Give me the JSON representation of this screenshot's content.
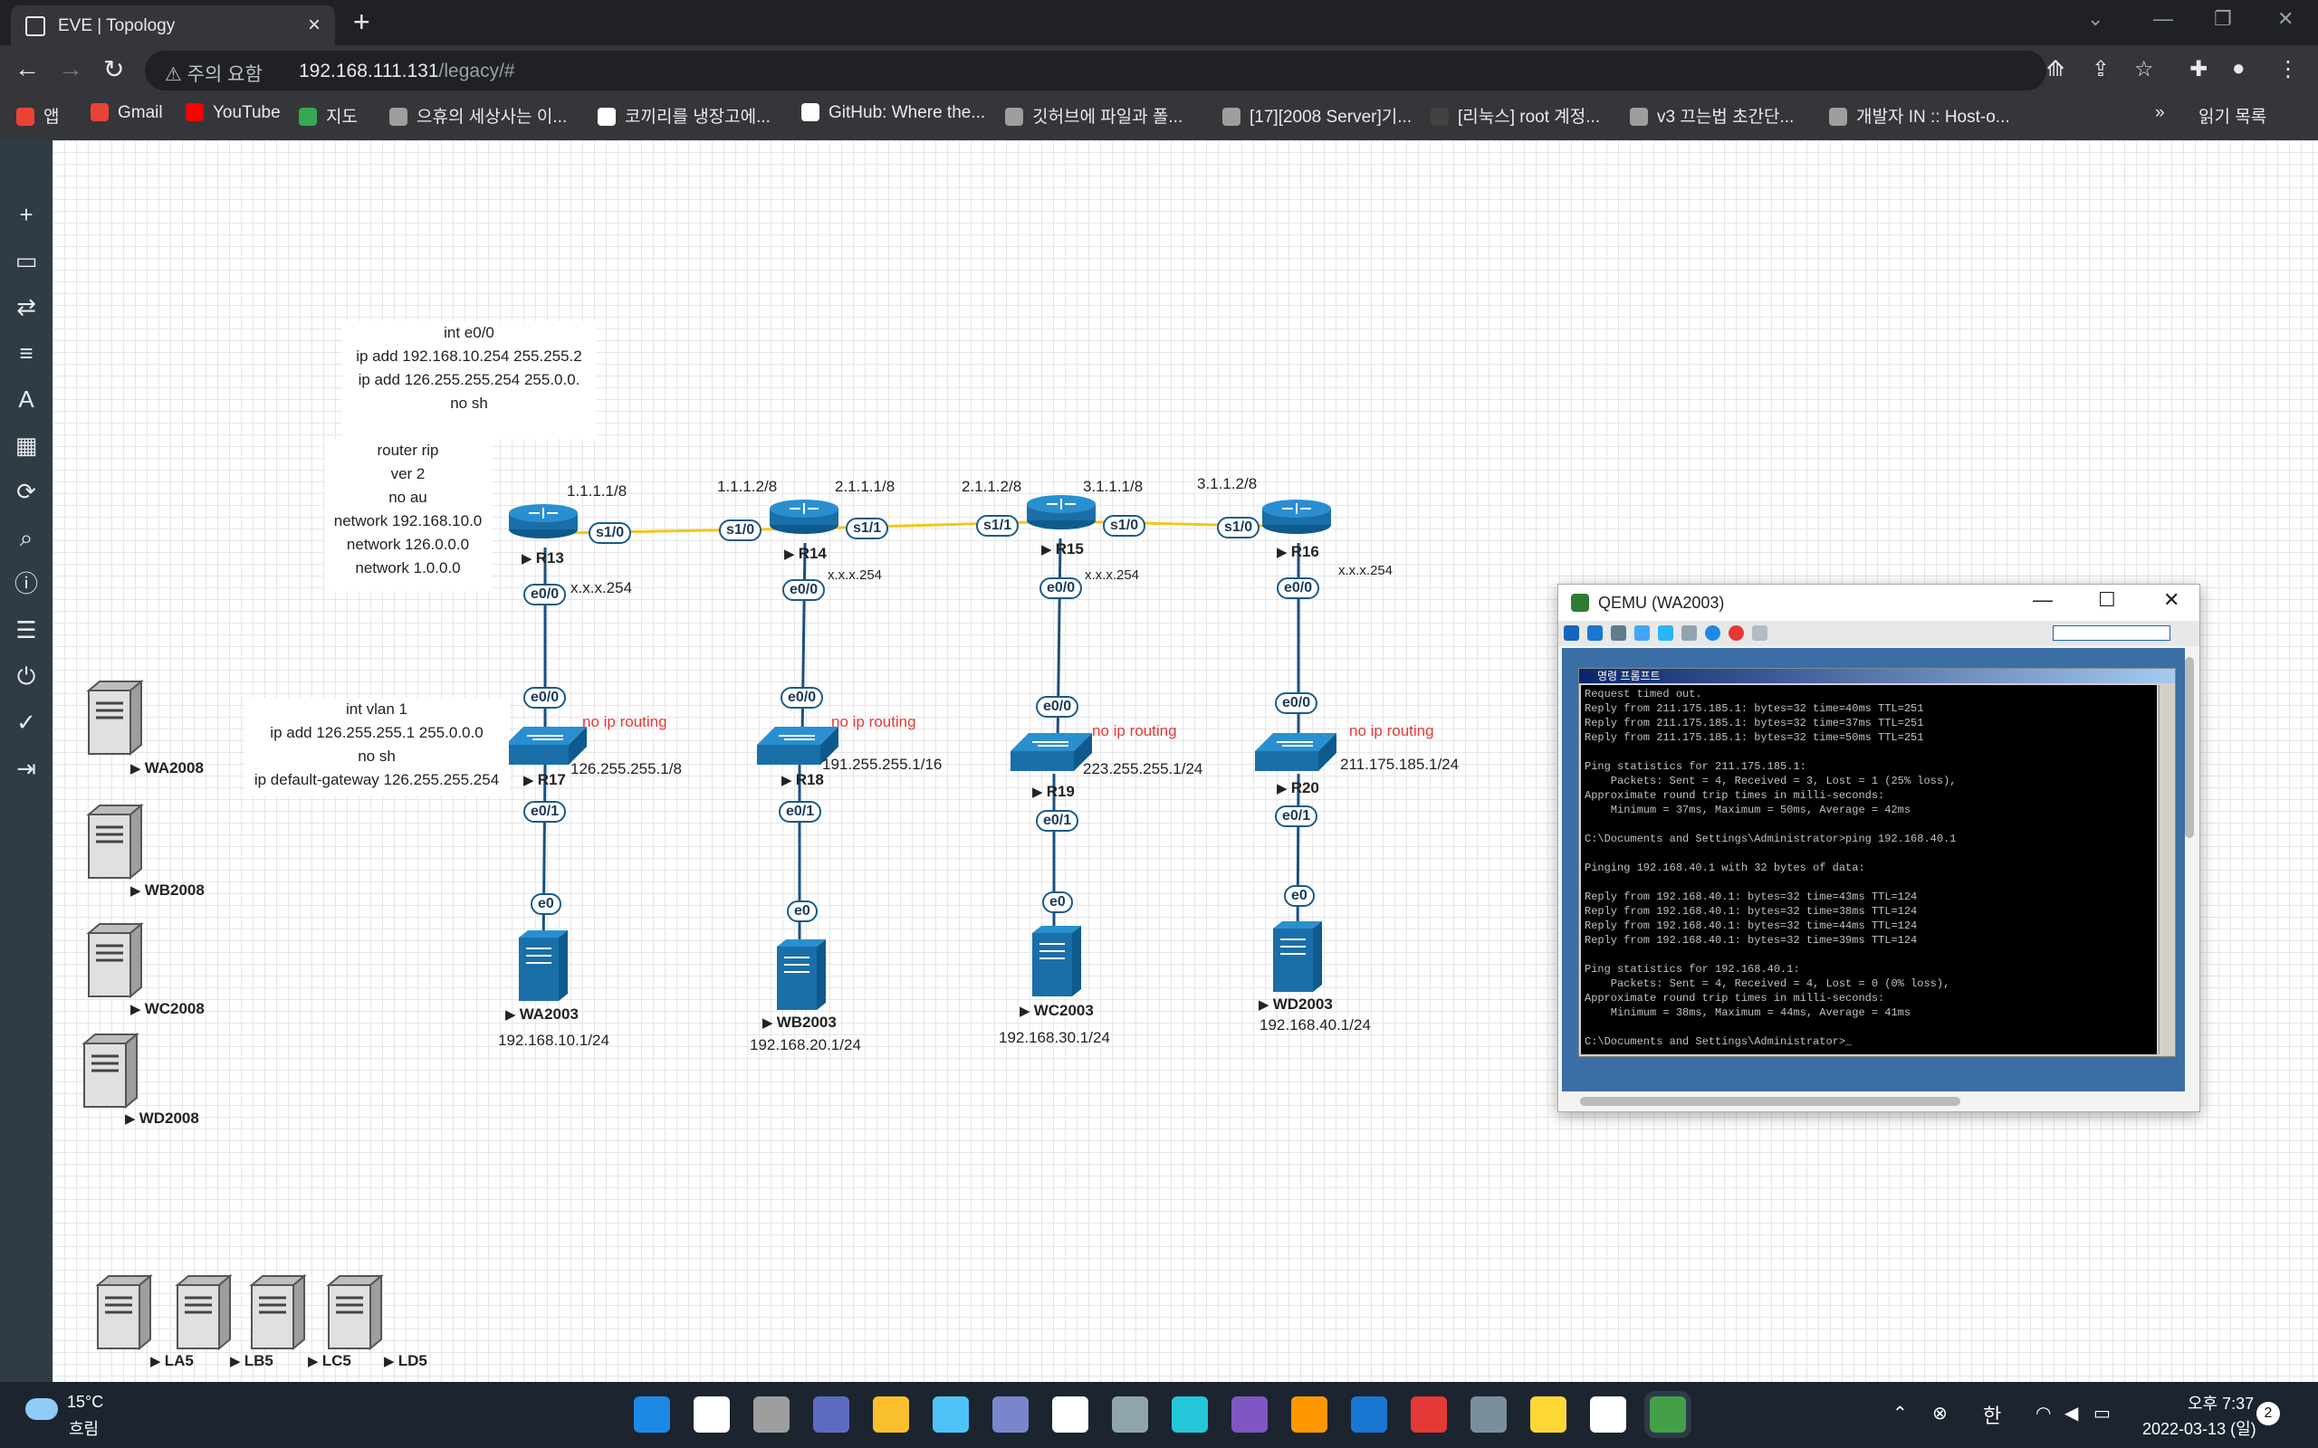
{
  "browser": {
    "tab_title": "EVE | Topology",
    "tab_close": "×",
    "new_tab": "+",
    "security_label": "⚠ 주의 요함",
    "url_host": "192.168.111.131",
    "url_path": "/legacy/#",
    "bookmarks": [
      {
        "label": "앱",
        "color": "#ea4335"
      },
      {
        "label": "Gmail",
        "color": "#ea4335"
      },
      {
        "label": "YouTube",
        "color": "#ff0000"
      },
      {
        "label": "지도",
        "color": "#34a853"
      },
      {
        "label": "으휴의 세상사는 이...",
        "color": "#9e9e9e"
      },
      {
        "label": "코끼리를 냉장고에...",
        "color": "#ffffff"
      },
      {
        "label": "GitHub: Where the...",
        "color": "#ffffff"
      },
      {
        "label": "깃허브에 파일과 폴...",
        "color": "#9e9e9e"
      },
      {
        "label": "[17][2008 Server]기...",
        "color": "#9e9e9e"
      },
      {
        "label": "[리눅스] root 계정...",
        "color": "#424242"
      },
      {
        "label": "v3 끄는법 초간단...",
        "color": "#9e9e9e"
      },
      {
        "label": "개발자 IN :: Host-o...",
        "color": "#9e9e9e"
      }
    ],
    "bookmarks_more": "»",
    "reading_list": "읽기 목록"
  },
  "sidebar": {
    "icons": [
      "plus-icon",
      "drive-icon",
      "arrows-icon",
      "list-icon",
      "text-icon",
      "grid-icon",
      "refresh-icon",
      "zoom-icon",
      "info-icon",
      "log-icon",
      "power-icon",
      "check-icon",
      "logout-icon"
    ],
    "glyphs": [
      "+",
      "▭",
      "⇄",
      "≡",
      "A",
      "▦",
      "⟳",
      "⌕",
      "ⓘ",
      "☰",
      "⏻",
      "✓",
      "⇥"
    ]
  },
  "topology": {
    "notes": [
      {
        "lines": [
          "int e0/0",
          "ip add 192.168.10.254 255.255.2",
          "ip add 126.255.255.254 255.0.0.",
          "no sh"
        ]
      },
      {
        "lines": [
          "router rip",
          "ver 2",
          "no au",
          "network 192.168.10.0",
          "network 126.0.0.0",
          "network 1.0.0.0"
        ]
      },
      {
        "lines": [
          "int vlan 1",
          "ip add 126.255.255.1 255.0.0.0",
          "no sh",
          "ip default-gateway 126.255.255.254"
        ]
      }
    ],
    "routers": [
      "R13",
      "R14",
      "R15",
      "R16"
    ],
    "switches": [
      "R17",
      "R18",
      "R19",
      "R20"
    ],
    "servers": [
      "WA2003",
      "WB2003",
      "WC2003",
      "WD2003"
    ],
    "server_ips": [
      "192.168.10.1/24",
      "192.168.20.1/24",
      "192.168.30.1/24",
      "192.168.40.1/24"
    ],
    "switch_ips": [
      "126.255.255.1/8",
      "191.255.255.1/16",
      "223.255.255.1/24",
      "211.175.185.1/24"
    ],
    "no_ip_routing": "no ip routing",
    "gateway_label": "x.x.x.254",
    "link_ips": [
      "1.1.1.1/8",
      "1.1.1.2/8",
      "2.1.1.1/8",
      "2.1.1.2/8",
      "3.1.1.1/8",
      "3.1.1.2/8"
    ],
    "serial_ports": [
      "s1/0",
      "s1/0",
      "s1/1",
      "s1/1",
      "s1/0",
      "s1/0"
    ],
    "port_e00": "e0/0",
    "port_e01": "e0/1",
    "port_e0": "e0",
    "left_servers": [
      "WA2008",
      "WB2008",
      "WC2008",
      "WD2008"
    ],
    "bottom_servers": [
      "LA5",
      "LB5",
      "LC5",
      "LD5"
    ]
  },
  "qemu": {
    "title": "QEMU (WA2003)",
    "cmd_title": "명령 프롬프트",
    "lines": [
      "Request timed out.",
      "Reply from 211.175.185.1: bytes=32 time=40ms TTL=251",
      "Reply from 211.175.185.1: bytes=32 time=37ms TTL=251",
      "Reply from 211.175.185.1: bytes=32 time=50ms TTL=251",
      "",
      "Ping statistics for 211.175.185.1:",
      "    Packets: Sent = 4, Received = 3, Lost = 1 (25% loss),",
      "Approximate round trip times in milli-seconds:",
      "    Minimum = 37ms, Maximum = 50ms, Average = 42ms",
      "",
      "C:\\Documents and Settings\\Administrator>ping 192.168.40.1",
      "",
      "Pinging 192.168.40.1 with 32 bytes of data:",
      "",
      "Reply from 192.168.40.1: bytes=32 time=43ms TTL=124",
      "Reply from 192.168.40.1: bytes=32 time=38ms TTL=124",
      "Reply from 192.168.40.1: bytes=32 time=44ms TTL=124",
      "Reply from 192.168.40.1: bytes=32 time=39ms TTL=124",
      "",
      "Ping statistics for 192.168.40.1:",
      "    Packets: Sent = 4, Received = 4, Lost = 0 (0% loss),",
      "Approximate round trip times in milli-seconds:",
      "    Minimum = 38ms, Maximum = 44ms, Average = 41ms",
      "",
      "C:\\Documents and Settings\\Administrator>_"
    ]
  },
  "taskbar": {
    "weather_temp": "15°C",
    "weather_desc": "흐림",
    "ime": "한",
    "time": "오후 7:37",
    "date": "2022-03-13 (일)",
    "notif_count": "2",
    "apps": [
      "#1e88e5",
      "#ffffff",
      "#9e9e9e",
      "#5c6bc0",
      "#fbc02d",
      "#4fc3f7",
      "#7986cb",
      "#ffffff",
      "#90a4ae",
      "#26c6da",
      "#7e57c2",
      "#ff9800",
      "#1976d2",
      "#e53935",
      "#78909c",
      "#fdd835",
      "#ffffff",
      "#43a047"
    ]
  }
}
